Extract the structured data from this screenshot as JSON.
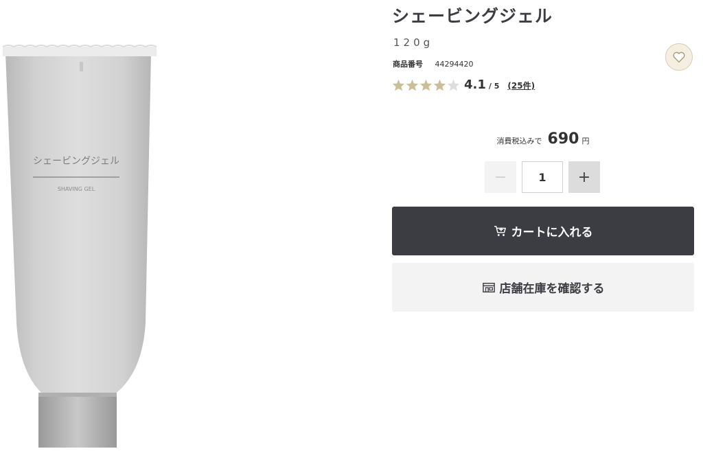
{
  "product": {
    "name": "シェービングジェル",
    "size": "120g",
    "sku_label": "商品番号",
    "sku_value": "44294420",
    "image_label_jp": "シェービングジェル",
    "image_label_en": "SHAVING GEL"
  },
  "rating": {
    "value": "4.1",
    "max": "/ 5",
    "stars_filled": 4,
    "stars_total": 5,
    "review_count": "(25件)"
  },
  "price": {
    "label": "消費税込みで",
    "value": "690",
    "unit": "円"
  },
  "quantity": {
    "minus": "−",
    "value": "1",
    "plus": "+"
  },
  "actions": {
    "cart": "カートに入れる",
    "store": "店舗在庫を確認する"
  },
  "icons": {
    "favorite": "heart-icon",
    "cart": "cart-icon",
    "store": "store-icon"
  },
  "colors": {
    "primary_dark": "#3c3c43",
    "star_filled": "#cbbf9a",
    "star_empty": "#dddddd",
    "favorite_bg": "#f4efe1"
  }
}
